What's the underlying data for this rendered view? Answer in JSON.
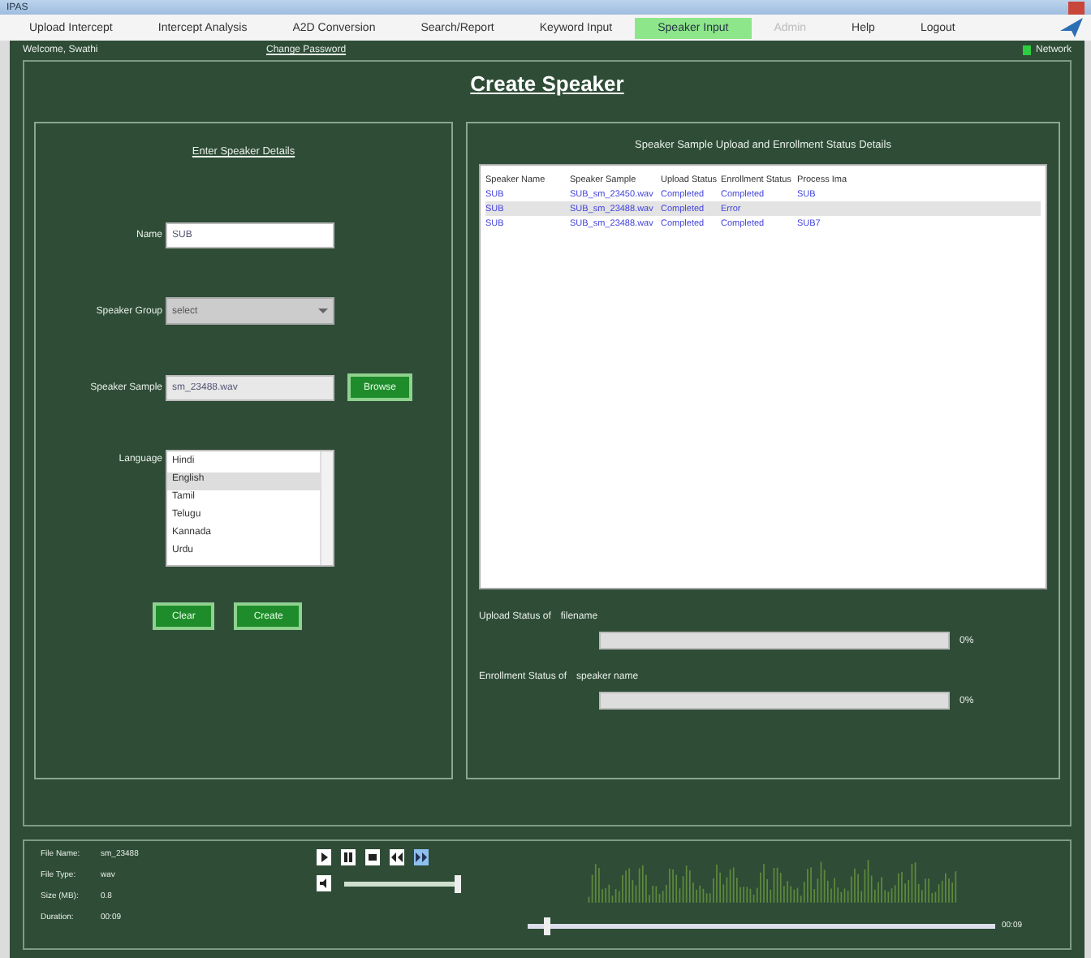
{
  "window": {
    "title": "IPAS"
  },
  "menu": [
    {
      "label": "Upload Intercept",
      "selected": false,
      "disabled": false
    },
    {
      "label": "Intercept Analysis",
      "selected": false,
      "disabled": false
    },
    {
      "label": "A2D Conversion",
      "selected": false,
      "disabled": false
    },
    {
      "label": "Search/Report",
      "selected": false,
      "disabled": false
    },
    {
      "label": "Keyword Input",
      "selected": false,
      "disabled": false
    },
    {
      "label": "Speaker Input",
      "selected": true,
      "disabled": false
    },
    {
      "label": "Admin",
      "selected": false,
      "disabled": true
    },
    {
      "label": "Help",
      "selected": false,
      "disabled": false
    },
    {
      "label": "Logout",
      "selected": false,
      "disabled": false
    }
  ],
  "user_bar": {
    "welcome": "Welcome, Swathi",
    "change_password": "Change Password",
    "network": "Network"
  },
  "page_title": "Create Speaker",
  "form": {
    "title": "Enter Speaker Details",
    "name": {
      "label": "Name",
      "value": "SUB"
    },
    "group": {
      "label": "Speaker Group",
      "value": "select"
    },
    "sample": {
      "label": "Speaker Sample",
      "value": "sm_23488.wav",
      "button": "Browse"
    },
    "language": {
      "label": "Language",
      "options": [
        {
          "label": "Hindi",
          "selected": false
        },
        {
          "label": "English",
          "selected": true
        },
        {
          "label": "Tamil",
          "selected": false
        },
        {
          "label": "Telugu",
          "selected": false
        },
        {
          "label": "Kannada",
          "selected": false
        },
        {
          "label": "Urdu",
          "selected": false
        }
      ]
    },
    "buttons": [
      "Clear",
      "Create"
    ]
  },
  "status": {
    "title": "Speaker Sample Upload and Enrollment Status Details",
    "table": {
      "columns": [
        "Speaker Name",
        "Speaker Sample",
        "Upload Status",
        "Enrollment Status",
        "Process Ima"
      ],
      "rows": [
        {
          "cells": [
            "SUB",
            "SUB_sm_23450.wav",
            "Completed",
            "Completed",
            "SUB"
          ],
          "selected": false
        },
        {
          "cells": [
            "SUB",
            "SUB_sm_23488.wav",
            "Completed",
            "Error",
            ""
          ],
          "selected": true
        },
        {
          "cells": [
            "SUB",
            "SUB_sm_23488.wav",
            "Completed",
            "Completed",
            "SUB7"
          ],
          "selected": false
        }
      ]
    },
    "upload": {
      "label": "Upload Status of",
      "target": "filename",
      "level": 0,
      "reading": "0%"
    },
    "enrollment": {
      "label": "Enrollment Status of",
      "target": "speaker name",
      "level": 0,
      "reading": "0%"
    }
  },
  "player": {
    "info": [
      {
        "label": "File Name:",
        "value": "sm_23488"
      },
      {
        "label": "File Type:",
        "value": "wav"
      },
      {
        "label": "Size (MB):",
        "value": "0.8"
      },
      {
        "label": "Duration:",
        "value": "00:09"
      }
    ],
    "volume": {
      "level": 1
    },
    "seek": {
      "level": 0.04
    },
    "time": "00:09"
  }
}
